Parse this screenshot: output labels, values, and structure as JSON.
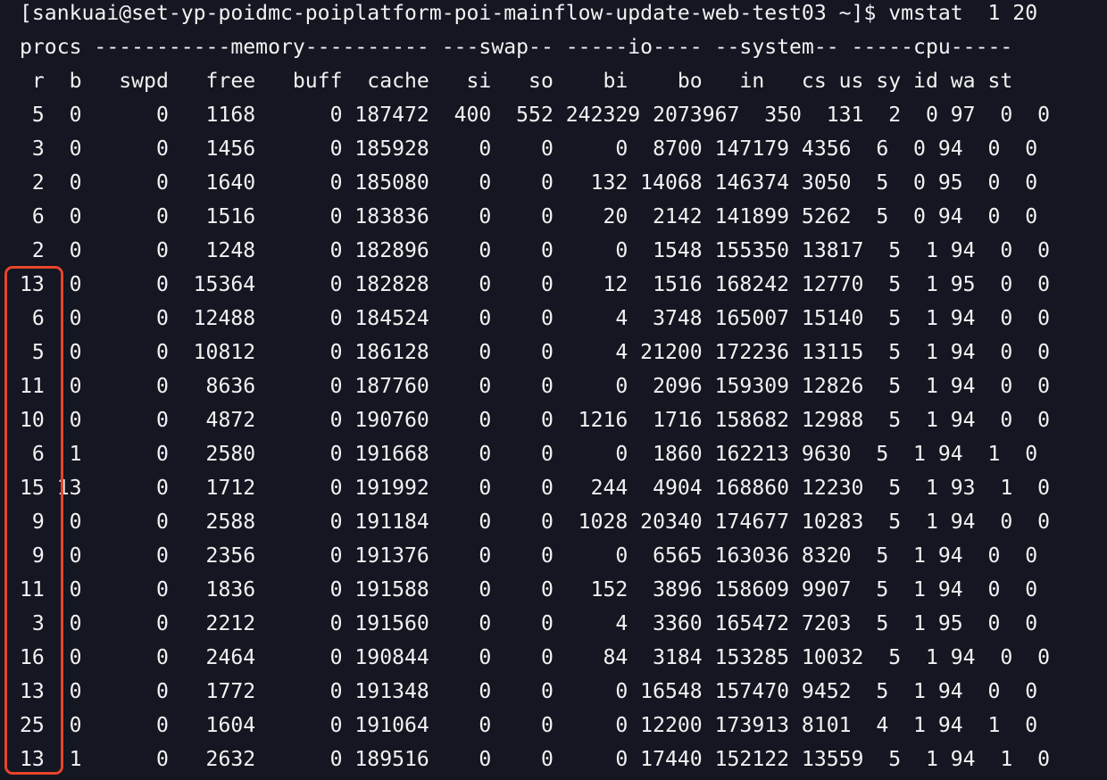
{
  "terminal": {
    "prompt": "[sankuai@set-yp-poidmc-poiplatform-poi-mainflow-update-web-test03 ~]$ vmstat  1 20",
    "header_groups": "procs -----------memory---------- ---swap-- -----io---- --system-- -----cpu-----",
    "header_columns": " r  b   swpd   free   buff  cache   si   so    bi    bo   in   cs us sy id wa st",
    "rows": [
      " 5  0      0   1168      0 187472  400  552 242329 2073967  350  131  2  0 97  0  0",
      " 3  0      0   1456      0 185928    0    0     0  8700 147179 4356  6  0 94  0  0",
      " 2  0      0   1640      0 185080    0    0   132 14068 146374 3050  5  0 95  0  0",
      " 6  0      0   1516      0 183836    0    0    20  2142 141899 5262  5  0 94  0  0",
      " 2  0      0   1248      0 182896    0    0     0  1548 155350 13817  5  1 94  0  0",
      "13  0      0  15364      0 182828    0    0    12  1516 168242 12770  5  1 95  0  0",
      " 6  0      0  12488      0 184524    0    0     4  3748 165007 15140  5  1 94  0  0",
      " 5  0      0  10812      0 186128    0    0     4 21200 172236 13115  5  1 94  0  0",
      "11  0      0   8636      0 187760    0    0     0  2096 159309 12826  5  1 94  0  0",
      "10  0      0   4872      0 190760    0    0  1216  1716 158682 12988  5  1 94  0  0",
      " 6  1      0   2580      0 191668    0    0     0  1860 162213 9630  5  1 94  1  0",
      "15 13      0   1712      0 191992    0    0   244  4904 168860 12230  5  1 93  1  0",
      " 9  0      0   2588      0 191184    0    0  1028 20340 174677 10283  5  1 94  0  0",
      " 9  0      0   2356      0 191376    0    0     0  6565 163036 8320  5  1 94  0  0",
      "11  0      0   1836      0 191588    0    0   152  3896 158609 9907  5  1 94  0  0",
      " 3  0      0   2212      0 191560    0    0     4  3360 165472 7203  5  1 95  0  0",
      "16  0      0   2464      0 190844    0    0    84  3184 153285 10032  5  1 94  0  0",
      "13  0      0   1772      0 191348    0    0     0 16548 157470 9452  5  1 94  0  0",
      "25  0      0   1604      0 191064    0    0     0 12200 173913 8101  4  1 94  1  0",
      "13  1      0   2632      0 189516    0    0     0 17440 152122 13559  5  1 94  1  0"
    ]
  },
  "annotation": {
    "color": "#e8442c"
  }
}
